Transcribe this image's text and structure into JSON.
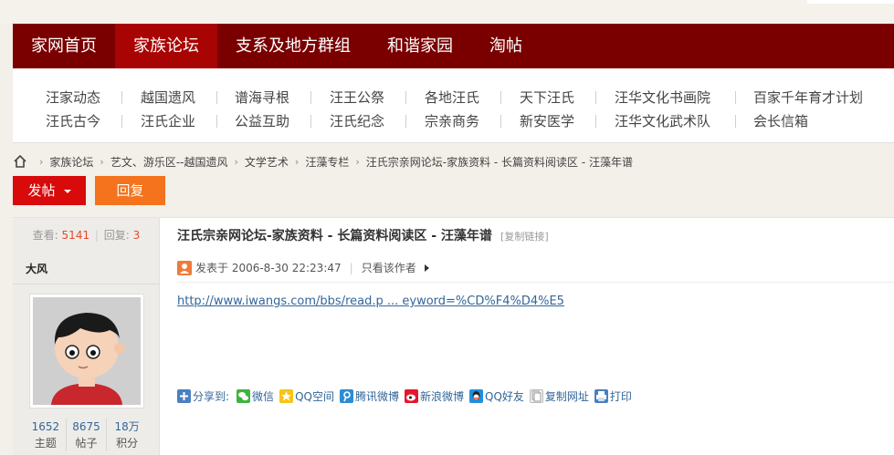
{
  "main_nav": [
    {
      "label": "家网首页",
      "active": false
    },
    {
      "label": "家族论坛",
      "active": true
    },
    {
      "label": "支系及地方群组",
      "active": false
    },
    {
      "label": "和谐家园",
      "active": false
    },
    {
      "label": "淘帖",
      "active": false
    }
  ],
  "sub_nav": {
    "row1": [
      "汪家动态",
      "越国遗风",
      "谱海寻根",
      "汪王公祭",
      "各地汪氏",
      "天下汪氏",
      "汪华文化书画院",
      "百家千年育才计划"
    ],
    "row2": [
      "汪氏古今",
      "汪氏企业",
      "公益互助",
      "汪氏纪念",
      "宗亲商务",
      "新安医学",
      "汪华文化武术队",
      "会长信箱"
    ]
  },
  "breadcrumb": [
    "家族论坛",
    "艺文、游乐区--越国遗风",
    "文学艺术",
    "汪藻专栏",
    "汪氏宗亲网论坛-家族资料 - 长篇资料阅读区 - 汪藻年谱"
  ],
  "buttons": {
    "post": "发帖",
    "reply": "回复"
  },
  "thread_stats": {
    "views_label": "查看:",
    "views": "5141",
    "replies_label": "回复:",
    "replies": "3"
  },
  "author": {
    "name": "大风",
    "stats": [
      {
        "value": "1652",
        "label": "主题"
      },
      {
        "value": "8675",
        "label": "帖子"
      },
      {
        "value": "18万",
        "label": "积分"
      }
    ]
  },
  "post": {
    "title": "汪氏宗亲网论坛-家族资料 - 长篇资料阅读区 - 汪藻年谱",
    "copy_link": "[复制链接]",
    "posted": "发表于 2006-8-30 22:23:47",
    "only_author": "只看该作者",
    "link_text": "http://www.iwangs.com/bbs/read.p ... eyword=%CD%F4%D4%E5"
  },
  "share": {
    "lead": "分享到:",
    "items": [
      {
        "label": "微信",
        "icon": "wechat-icon",
        "color": "#3fb33f"
      },
      {
        "label": "QQ空间",
        "icon": "qzone-icon",
        "color": "#f5c518"
      },
      {
        "label": "腾讯微博",
        "icon": "tencent-weibo-icon",
        "color": "#2c8cd4"
      },
      {
        "label": "新浪微博",
        "icon": "sina-weibo-icon",
        "color": "#e6162d"
      },
      {
        "label": "QQ好友",
        "icon": "qq-icon",
        "color": "#1f8fe0"
      },
      {
        "label": "复制网址",
        "icon": "copy-icon",
        "color": "#bbbbbb"
      },
      {
        "label": "打印",
        "icon": "print-icon",
        "color": "#4a7fc1"
      }
    ]
  },
  "colors": {
    "nav_bg": "#7a0000",
    "nav_active": "#a90404",
    "post_btn": "#d80a0a",
    "reply_btn": "#f4731c",
    "link": "#336699"
  }
}
